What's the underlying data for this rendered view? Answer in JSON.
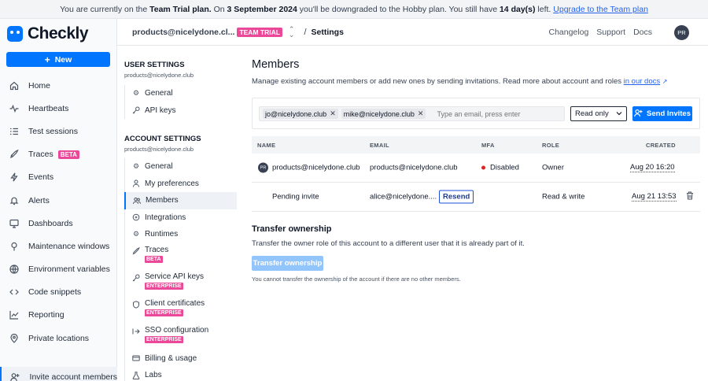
{
  "banner": {
    "t1": "You are currently on the ",
    "plan": "Team Trial plan.",
    "t2": " On ",
    "date": "3 September 2024",
    "t3": " you'll be downgraded to the Hobby plan. You still have ",
    "days": "14 day(s)",
    "t4": " left. ",
    "link": "Upgrade to the Team plan"
  },
  "brand": {
    "name": "Checkly"
  },
  "leftnav": {
    "new_label": "New",
    "items": [
      {
        "label": "Home",
        "icon": "home-icon"
      },
      {
        "label": "Heartbeats",
        "icon": "heartbeat-icon"
      },
      {
        "label": "Test sessions",
        "icon": "list-icon"
      },
      {
        "label": "Traces",
        "icon": "rocket-icon",
        "badge": "BETA"
      },
      {
        "label": "Events",
        "icon": "zap-icon"
      },
      {
        "label": "Alerts",
        "icon": "bell-icon"
      },
      {
        "label": "Dashboards",
        "icon": "monitor-icon"
      },
      {
        "label": "Maintenance windows",
        "icon": "wrench-icon"
      },
      {
        "label": "Environment variables",
        "icon": "globe-icon"
      },
      {
        "label": "Code snippets",
        "icon": "code-icon"
      },
      {
        "label": "Reporting",
        "icon": "chart-icon"
      },
      {
        "label": "Private locations",
        "icon": "location-pin-icon"
      }
    ],
    "invite_label": "Invite account members"
  },
  "topbar": {
    "account": "products@nicelydone.cl...",
    "trial_badge": "TEAM TRIAL",
    "separator": "/",
    "crumb": "Settings",
    "links": [
      "Changelog",
      "Support",
      "Docs"
    ],
    "avatar": "PR"
  },
  "subnav": {
    "user_title": "USER SETTINGS",
    "user_email": "products@nicelydone.club",
    "user_items": [
      "General",
      "API keys"
    ],
    "account_title": "ACCOUNT SETTINGS",
    "account_email": "products@nicelydone.club",
    "account_items": [
      {
        "label": "General"
      },
      {
        "label": "My preferences"
      },
      {
        "label": "Members",
        "active": true
      },
      {
        "label": "Integrations"
      },
      {
        "label": "Runtimes"
      },
      {
        "label": "Traces",
        "badge": "BETA"
      },
      {
        "label": "Service API keys",
        "badge": "ENTERPRISE"
      },
      {
        "label": "Client certificates",
        "badge": "ENTERPRISE"
      },
      {
        "label": "SSO configuration",
        "badge": "ENTERPRISE"
      },
      {
        "label": "Billing & usage"
      },
      {
        "label": "Labs"
      }
    ]
  },
  "main": {
    "title": "Members",
    "desc": "Manage existing account members or add new ones by sending invitations. Read more about account and roles ",
    "docs_link": "in our docs",
    "invite": {
      "chips": [
        "jo@nicelydone.club",
        "mike@nicelydone.club"
      ],
      "placeholder": "Type an email, press enter",
      "role": "Read only",
      "send_label": "Send Invites"
    },
    "table": {
      "headers": {
        "name": "NAME",
        "email": "EMAIL",
        "mfa": "MFA",
        "role": "ROLE",
        "created": "CREATED"
      },
      "rows": [
        {
          "avatar": "PR",
          "name": "products@nicelydone.club",
          "email": "products@nicelydone.club",
          "mfa": "Disabled",
          "role": "Owner",
          "created": "Aug 20 16:20"
        },
        {
          "name": "Pending invite",
          "email": "alice@nicelydone....",
          "action": "Resend",
          "role": "Read & write",
          "created": "Aug 21 13:53"
        }
      ]
    },
    "transfer": {
      "title": "Transfer ownership",
      "desc": "Transfer the owner role of this account to a different user that it is already part of it.",
      "button": "Transfer ownership",
      "note": "You cannot transfer the ownership of the account if there are no other members."
    }
  }
}
